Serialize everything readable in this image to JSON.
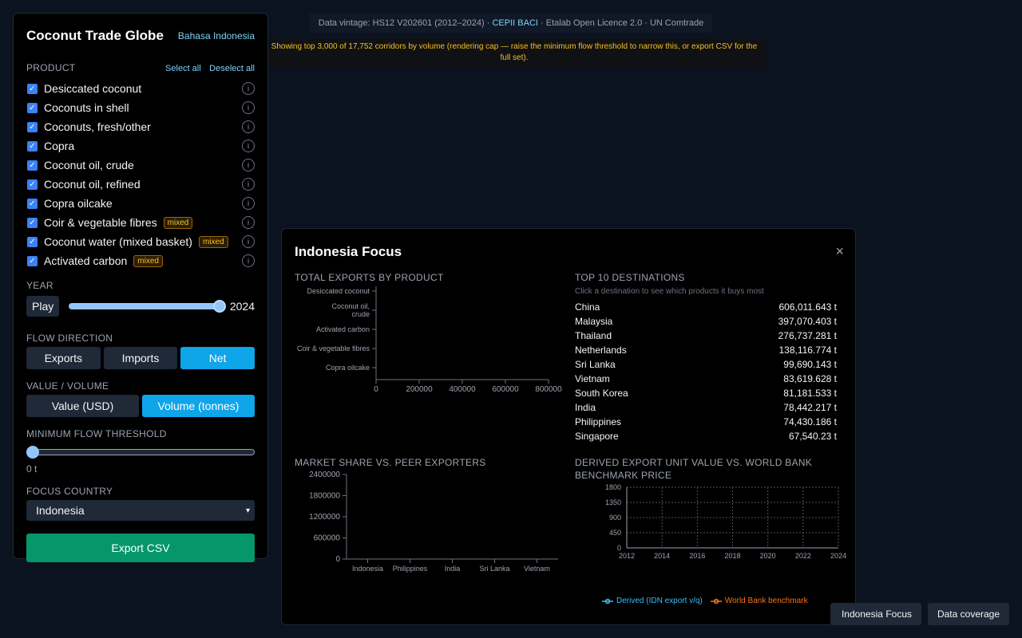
{
  "banner": {
    "vintage_prefix": "Data vintage: HS12 V202601 (2012–2024) · ",
    "vintage_link": "CEPII BACI",
    "vintage_suffix": " · Etalab Open Licence 2.0 · UN Comtrade",
    "cap_notice": "Showing top 3,000 of 17,752 corridors by volume (rendering cap — raise the minimum flow threshold to narrow this, or export CSV for the full set)."
  },
  "sidebar": {
    "title": "Coconut Trade Globe",
    "language_link": "Bahasa Indonesia",
    "product_label": "PRODUCT",
    "select_all": "Select all",
    "deselect_all": "Deselect all",
    "products": [
      {
        "name": "Desiccated coconut",
        "checked": true,
        "badge": ""
      },
      {
        "name": "Coconuts in shell",
        "checked": true,
        "badge": ""
      },
      {
        "name": "Coconuts, fresh/other",
        "checked": true,
        "badge": ""
      },
      {
        "name": "Copra",
        "checked": true,
        "badge": ""
      },
      {
        "name": "Coconut oil, crude",
        "checked": true,
        "badge": ""
      },
      {
        "name": "Coconut oil, refined",
        "checked": true,
        "badge": ""
      },
      {
        "name": "Copra oilcake",
        "checked": true,
        "badge": ""
      },
      {
        "name": "Coir & vegetable fibres",
        "checked": true,
        "badge": "mixed"
      },
      {
        "name": "Coconut water (mixed basket)",
        "checked": true,
        "badge": "mixed"
      },
      {
        "name": "Activated carbon",
        "checked": true,
        "badge": "mixed"
      }
    ],
    "info_glyph": "i",
    "year_label": "YEAR",
    "play_label": "Play",
    "year_value": "2024",
    "flow_label": "FLOW DIRECTION",
    "flow_options": [
      "Exports",
      "Imports",
      "Net"
    ],
    "flow_selected": "Net",
    "metric_label": "VALUE / VOLUME",
    "metric_options": [
      "Value (USD)",
      "Volume (tonnes)"
    ],
    "metric_selected": "Volume (tonnes)",
    "threshold_label": "MINIMUM FLOW THRESHOLD",
    "threshold_value": "0 t",
    "focus_label": "FOCUS COUNTRY",
    "focus_value": "Indonesia",
    "export_label": "Export CSV"
  },
  "panel": {
    "title": "Indonesia Focus",
    "close": "×",
    "exports_by_product_title": "TOTAL EXPORTS BY PRODUCT",
    "top_dest_title": "TOP 10 DESTINATIONS",
    "top_dest_hint": "Click a destination to see which products it buys most",
    "destinations": [
      {
        "country": "China",
        "volume": "606,011.643 t"
      },
      {
        "country": "Malaysia",
        "volume": "397,070.403 t"
      },
      {
        "country": "Thailand",
        "volume": "276,737.281 t"
      },
      {
        "country": "Netherlands",
        "volume": "138,116.774 t"
      },
      {
        "country": "Sri Lanka",
        "volume": "99,690.143 t"
      },
      {
        "country": "Vietnam",
        "volume": "83,619.628 t"
      },
      {
        "country": "South Korea",
        "volume": "81,181.533 t"
      },
      {
        "country": "India",
        "volume": "78,442.217 t"
      },
      {
        "country": "Philippines",
        "volume": "74,430.186 t"
      },
      {
        "country": "Singapore",
        "volume": "67,540.23 t"
      }
    ],
    "market_share_title": "MARKET SHARE VS. PEER EXPORTERS",
    "unit_value_title_1": "DERIVED EXPORT UNIT VALUE VS. WORLD BANK",
    "unit_value_title_2": "BENCHMARK PRICE",
    "legend": [
      {
        "name": "Derived (IDN export v/q)",
        "color": "#38bdf8"
      },
      {
        "name": "World Bank benchmark",
        "color": "#f97316"
      }
    ]
  },
  "bottom": {
    "focus_button": "Indonesia Focus",
    "coverage_button": "Data coverage"
  },
  "colors": {
    "accent": "#0ea5e9",
    "export_button": "#059669",
    "badge": "#fbbf24"
  },
  "chart_data": [
    {
      "type": "bar",
      "orientation": "horizontal",
      "title": "TOTAL EXPORTS BY PRODUCT",
      "categories": [
        "Desiccated coconut",
        "Coconut oil, crude",
        "Activated carbon",
        "Coir & vegetable fibres",
        "Copra oilcake"
      ],
      "x_ticks": [
        0,
        200000,
        400000,
        600000,
        800000
      ],
      "xlim": [
        0,
        800000
      ],
      "values": []
    },
    {
      "type": "bar",
      "title": "MARKET SHARE VS. PEER EXPORTERS",
      "categories": [
        "Indonesia",
        "Philippines",
        "India",
        "Sri Lanka",
        "Vietnam"
      ],
      "y_ticks": [
        0,
        600000,
        1200000,
        1800000,
        2400000
      ],
      "ylim": [
        0,
        2400000
      ],
      "values": []
    },
    {
      "type": "line",
      "title": "DERIVED EXPORT UNIT VALUE VS. WORLD BANK BENCHMARK PRICE",
      "x_ticks": [
        2012,
        2014,
        2016,
        2018,
        2020,
        2022,
        2024
      ],
      "xlim": [
        2012,
        2024
      ],
      "y_ticks": [
        0,
        450,
        900,
        1350,
        1800
      ],
      "ylim": [
        0,
        1800
      ],
      "grid": true,
      "legend": "bottom",
      "series": [
        {
          "name": "Derived (IDN export v/q)",
          "values": []
        },
        {
          "name": "World Bank benchmark",
          "values": []
        }
      ]
    }
  ]
}
